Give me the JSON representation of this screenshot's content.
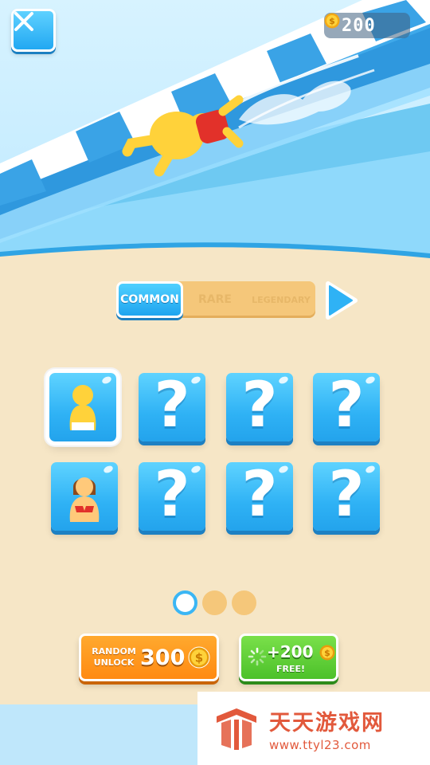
{
  "header": {
    "coins": "200",
    "close_icon": "close-icon",
    "coin_icon": "coin-icon"
  },
  "tabs": [
    {
      "label": "COMMON",
      "active": true
    },
    {
      "label": "RARE",
      "active": false
    },
    {
      "label": "LEGENDARY",
      "active": false
    }
  ],
  "grid": {
    "cards": [
      {
        "kind": "character",
        "icon": "yellow-character-icon",
        "selected": true
      },
      {
        "kind": "locked",
        "label": "?"
      },
      {
        "kind": "locked",
        "label": "?"
      },
      {
        "kind": "locked",
        "label": "?"
      },
      {
        "kind": "character",
        "icon": "bikini-character-icon",
        "selected": false
      },
      {
        "kind": "locked",
        "label": "?"
      },
      {
        "kind": "locked",
        "label": "?"
      },
      {
        "kind": "locked",
        "label": "?"
      }
    ]
  },
  "pagination": {
    "pages": 3,
    "current": 1
  },
  "buttons": {
    "random_unlock_label": "RANDOM UNLOCK",
    "random_unlock_price": "300",
    "free_amount": "+200",
    "free_label": "FREE!"
  },
  "watermark": {
    "title": "天天游戏网",
    "url": "www.ttyl23.com"
  },
  "colors": {
    "accent_blue": "#2fb2f5",
    "tab_bg": "#f5c77a",
    "orange": "#ff8a12",
    "green": "#4cc12a",
    "sand": "#f6e6c6"
  }
}
